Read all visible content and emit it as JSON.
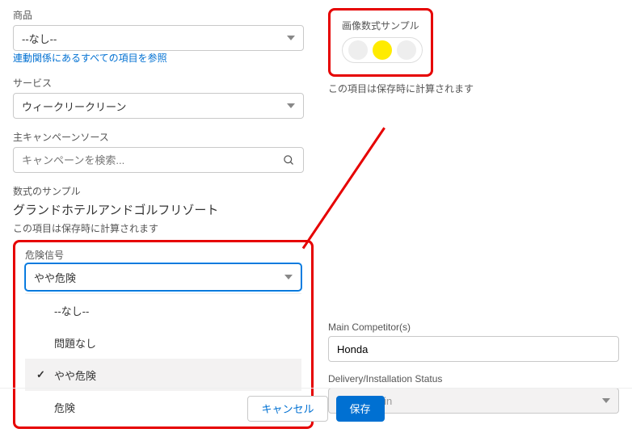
{
  "product": {
    "label": "商品",
    "value": "--なし--",
    "relatedLink": "連動関係にあるすべての項目を参照"
  },
  "service": {
    "label": "サービス",
    "value": "ウィークリークリーン"
  },
  "campaign": {
    "label": "主キャンペーンソース",
    "placeholder": "キャンペーンを検索..."
  },
  "formula": {
    "label": "数式のサンプル",
    "value": "グランドホテルアンドゴルフリゾート",
    "help": "この項目は保存時に計算されます"
  },
  "risk": {
    "label": "危険信号",
    "selected": "やや危険",
    "options": [
      "--なし--",
      "問題なし",
      "やや危険",
      "危険"
    ]
  },
  "imageFormula": {
    "label": "画像数式サンプル",
    "help": "この項目は保存時に計算されます"
  },
  "competitor": {
    "label": "Main Competitor(s)",
    "value": "Honda"
  },
  "delivery": {
    "label": "Delivery/Installation Status",
    "value": "Yet to begin"
  },
  "buttons": {
    "cancel": "キャンセル",
    "save": "保存"
  },
  "colors": {
    "accent": "#0070d2",
    "highlight": "#e60000"
  }
}
